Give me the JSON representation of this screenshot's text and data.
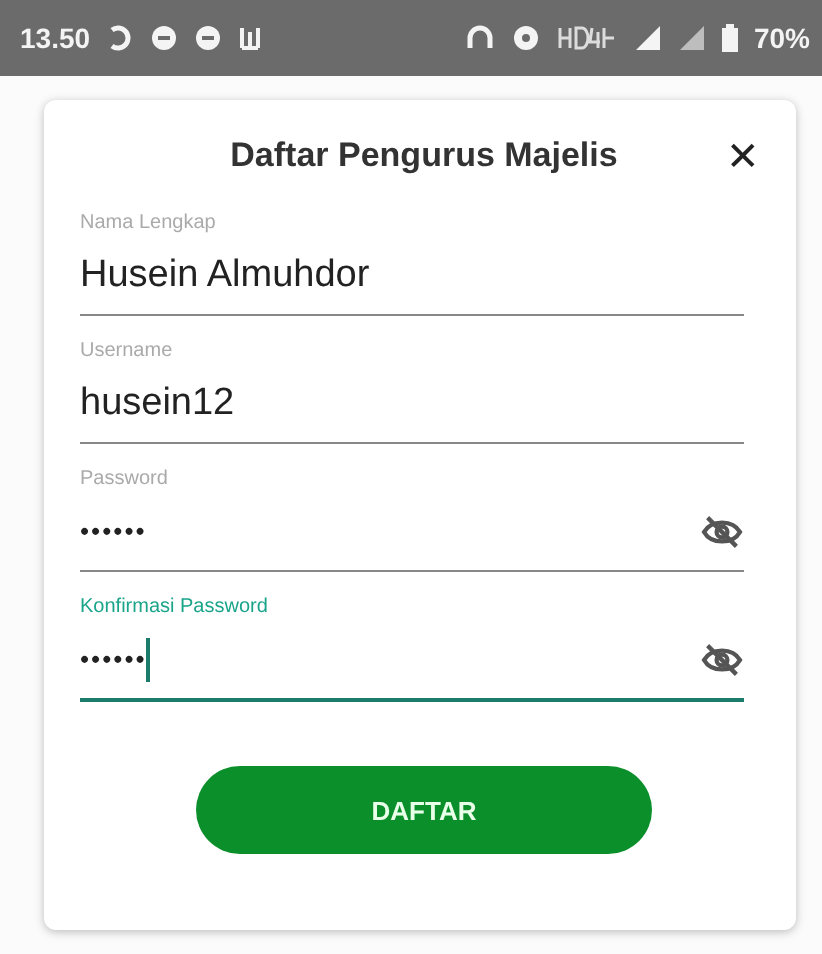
{
  "status_bar": {
    "time": "13.50",
    "battery": "70%"
  },
  "dialog": {
    "title": "Daftar Pengurus Majelis",
    "close": "✕",
    "fields": [
      {
        "kind": "text",
        "label": "Nama Lengkap",
        "value": "Husein Almuhdor",
        "focused": false
      },
      {
        "kind": "text",
        "label": "Username",
        "value": "husein12",
        "focused": false
      },
      {
        "kind": "password",
        "label": "Password",
        "value": "••••••",
        "focused": false
      },
      {
        "kind": "password",
        "label": "Konfirmasi Password",
        "value": "••••••",
        "focused": true
      }
    ],
    "submit": "DAFTAR"
  }
}
